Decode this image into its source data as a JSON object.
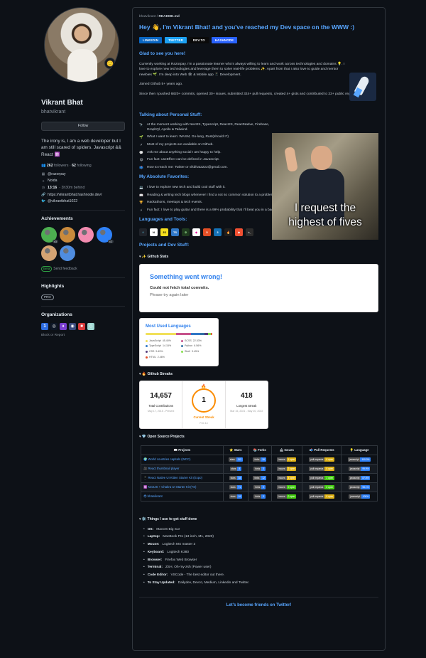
{
  "profile": {
    "name": "Vikrant Bhat",
    "login": "bhatvikrant",
    "status_emoji": "🙂",
    "follow_label": "Follow",
    "bio": "The irony is, I am a web developer but I am still scared of spiders. Javascript && React ⚛️",
    "followers_count": "262",
    "followers_label": "followers",
    "following_count": "62",
    "following_label": "following",
    "company": "@razorpay",
    "location": "Noida",
    "local_time": "13:16",
    "time_note": "- 3h30m behind",
    "website": "https://vikrantbhat.hashnode.dev/",
    "twitter": "@vikrantbhat1022"
  },
  "achievements": {
    "heading": "Achievements",
    "items": [
      {
        "name": "galaxy-brain",
        "count": "x3",
        "color": "#4caf50"
      },
      {
        "name": "pull-shark",
        "count": "",
        "color": "#c98a3c"
      },
      {
        "name": "yolo",
        "count": "",
        "color": "#f28bb0"
      },
      {
        "name": "starstruck",
        "count": "x2",
        "color": "#2f81f7"
      },
      {
        "name": "quickdraw",
        "count": "",
        "color": "#d4a373"
      },
      {
        "name": "arctic-code-vault",
        "count": "",
        "color": "#4f8de0"
      }
    ],
    "beta_label": "Beta",
    "feedback_label": "Send feedback"
  },
  "highlights": {
    "heading": "Highlights",
    "pro_label": "PRO"
  },
  "organizations": {
    "heading": "Organizations",
    "items": [
      {
        "name": "org-1",
        "glyph": "1",
        "color": "#2d6cdf"
      },
      {
        "name": "org-2",
        "glyph": "◎",
        "color": "#0e1726"
      },
      {
        "name": "org-3",
        "glyph": "♦",
        "color": "#7a3fd1"
      },
      {
        "name": "org-4",
        "glyph": "◉",
        "color": "#3b4a7c"
      },
      {
        "name": "org-5",
        "glyph": "■",
        "color": "#d93b3b"
      },
      {
        "name": "org-6",
        "glyph": "◇",
        "color": "#9fd8d2"
      }
    ],
    "report_label": "Block or Report"
  },
  "readme": {
    "path_user": "bhatvikrant",
    "path_file": "README.md",
    "hero_prefix": "Hey 👋, I'm Vikrant Bhat!",
    "hero_suffix": "and you've reached my Dev space on the WWW :)",
    "badges": [
      {
        "label": "LINKEDIN",
        "color": "#0a66c2"
      },
      {
        "label": "TWITTER",
        "color": "#1da1f2"
      },
      {
        "label": "DEV.TO",
        "color": "#0a0a0a"
      },
      {
        "label": "HASHNODE",
        "color": "#2962ff"
      }
    ],
    "glad_heading": "Glad to see you here!",
    "intro_text": "Currently working at Razorpay. I'm a passionate learner who's always willing to learn and work across technologies and domains 💡. I love to explore new technologies and leverage them to solve real-life problems ✨. Apart from that I also love to guide and mentor newbies 🌱. I'm deep into Web 🕸 & Mobile app 📱 Development.",
    "joined_text": "Joined Github 5+ years ago.",
    "since_text": "Since then I pushed 6820+ commits, opened 30+ issues, submitted 324+ pull requests, created 4+ gists and contributed to 23+ public repositories.",
    "personal_heading": "Talking about Personal Stuff:",
    "personal_items": [
      {
        "emoji": "🔭",
        "text": "At the moment working with NextJS, Typescript, ReactJS, ReactNative, Firebase, GraphQl, Apollo & Tailwind."
      },
      {
        "emoji": "🌱",
        "text": "What I want to learn: WASM, Go-lang, Rust(should I?)"
      },
      {
        "emoji": "⚡",
        "text": "Most of my projects are available on Github."
      },
      {
        "emoji": "💬",
        "text": "Ask me about anything social I am happy to help."
      },
      {
        "emoji": "😄",
        "text": "Fun fact: useEffect can be defined in Javascript."
      },
      {
        "emoji": "📫",
        "text": "How to reach me: Twitter or vikbhat2222@gmail.com."
      }
    ],
    "absolute_heading": "My Absolute Favorites:",
    "absolute_items": [
      {
        "emoji": "💻",
        "text": "I love to explore new tech and build cool stuff with it."
      },
      {
        "emoji": "📖",
        "text": "Reading & writing tech blogs whenever I find a not so common solution to a problem that I personally faced."
      },
      {
        "emoji": "🏆",
        "text": "Hackathons, meetups & tech events."
      },
      {
        "emoji": "⚡",
        "text": "Fun fact: I love to play guitar and there is a 99% probability that I'll beat you in a badminton match 😄"
      }
    ],
    "gif_caption_1": "I request the",
    "gif_caption_2": "highest of fives",
    "tools_heading": "Languages and Tools:",
    "tools": [
      {
        "name": "react",
        "glyph": "⚛",
        "color": "#20232a",
        "fg": "#61dafb"
      },
      {
        "name": "nextjs",
        "glyph": "N",
        "color": "#ffffff",
        "fg": "#000000"
      },
      {
        "name": "javascript",
        "glyph": "JS",
        "color": "#f7df1e",
        "fg": "#000000"
      },
      {
        "name": "typescript",
        "glyph": "TS",
        "color": "#3178c6",
        "fg": "#ffffff"
      },
      {
        "name": "nodejs",
        "glyph": "⬢",
        "color": "#1f3a1f",
        "fg": "#68a063"
      },
      {
        "name": "graphql",
        "glyph": "◆",
        "color": "#ffffff",
        "fg": "#e10098"
      },
      {
        "name": "html5",
        "glyph": "5",
        "color": "#e34f26",
        "fg": "#ffffff"
      },
      {
        "name": "css3",
        "glyph": "3",
        "color": "#1572b6",
        "fg": "#ffffff"
      },
      {
        "name": "firebase",
        "glyph": "🔥",
        "color": "#1f1f1f",
        "fg": "#ffca28"
      },
      {
        "name": "git",
        "glyph": "◆",
        "color": "#f05032",
        "fg": "#ffffff"
      },
      {
        "name": "bash",
        "glyph": ">_",
        "color": "#2b2b2b",
        "fg": "#ffffff"
      }
    ],
    "projects_heading": "Projects and Dev Stuff:",
    "github_stats_label": "▾ ✨ Github Stats",
    "stats_error_title": "Something went wrong!",
    "stats_error_line1": "Could not fetch total commits.",
    "stats_error_line2": "Please try again later",
    "langs_title": "Most Used Languages",
    "languages": [
      {
        "name": "JavaScript",
        "pct": "45.40%",
        "color": "#f1e05a"
      },
      {
        "name": "SCSS",
        "pct": "22.53%",
        "color": "#c6538c"
      },
      {
        "name": "TypeScript",
        "pct": "14.15%",
        "color": "#3178c6"
      },
      {
        "name": "Python",
        "pct": "6.56%",
        "color": "#3572a5"
      },
      {
        "name": "CSS",
        "pct": "5.45%",
        "color": "#563d7c"
      },
      {
        "name": "Shell",
        "pct": "3.45%",
        "color": "#89e051"
      },
      {
        "name": "HTML",
        "pct": "2.46%",
        "color": "#e34c26"
      }
    ],
    "streak_label": "▾ 🔥 Github Streaks",
    "streak": {
      "total": "14,657",
      "total_label": "Total Contributions",
      "total_range": "May 17, 2015 - Present",
      "current": "1",
      "current_label": "Current Streak",
      "current_range": "Feb 14",
      "longest": "418",
      "longest_label": "Longest Streak",
      "longest_range": "Mar 15, 2021 - May 20, 2022"
    },
    "oss_label": "▾ 💎 Open Source Projects",
    "oss_headers": [
      "📖 Projects",
      "⭐ Stars",
      "📚 Forks",
      "🛎 Issues",
      "📬 Pull Requests",
      "💡 Language"
    ],
    "oss_rows": [
      {
        "project": "🌍 World countries capitals (WCC)",
        "stars": "112",
        "forks": "26",
        "issues": "1 open",
        "prs": "0 open",
        "lang": "100.0%"
      },
      {
        "project": "🎥 React thumbnail player",
        "stars": "8",
        "forks": "3",
        "issues": "2 open",
        "prs": "0 open",
        "lang": "99.9%"
      },
      {
        "project": "📱 React Native UI Kitten Starter Kit (Expo)",
        "stars": "38",
        "forks": "12",
        "issues": "4 open",
        "prs": "1 open",
        "lang": "87.8%"
      },
      {
        "project": "⚛️ NextJS + Chakra UI Starter Kit (TS)",
        "stars": "71",
        "forks": "9",
        "issues": "0 open",
        "prs": "2 open",
        "lang": "98.1%"
      },
      {
        "project": "😎 bhatvikrant",
        "stars": "16",
        "forks": "3",
        "issues": "0 open",
        "prs": "0 open",
        "lang": "100%"
      }
    ],
    "oss_shield_labels": {
      "stars": "stars",
      "forks": "forks",
      "issues": "issues",
      "prs": "pull requests",
      "lang": "javascript"
    },
    "setup_label": "▾ ⚙️ Things I use to get stuff done",
    "setup": [
      {
        "k": "OS:",
        "v": "MacOS Big Sur"
      },
      {
        "k": "Laptop:",
        "v": "MacBook Pro (13-inch, M1, 2020)"
      },
      {
        "k": "Mouse:",
        "v": "Logitech MX master 3"
      },
      {
        "k": "Keyboard:",
        "v": "Logitech K380"
      },
      {
        "k": "Browser:",
        "v": "Firefox Web Browser"
      },
      {
        "k": "Terminal:",
        "v": "ZSH, Oh-my-zsh (Power user)"
      },
      {
        "k": "Code Editor:",
        "v": "VSCode - The best editor out there."
      },
      {
        "k": "To Stay Updated:",
        "v": "Dailydev, Dev.to, Medium, Linkedin and Twitter."
      }
    ],
    "footer_link": "Let's become friends on Twitter!"
  }
}
